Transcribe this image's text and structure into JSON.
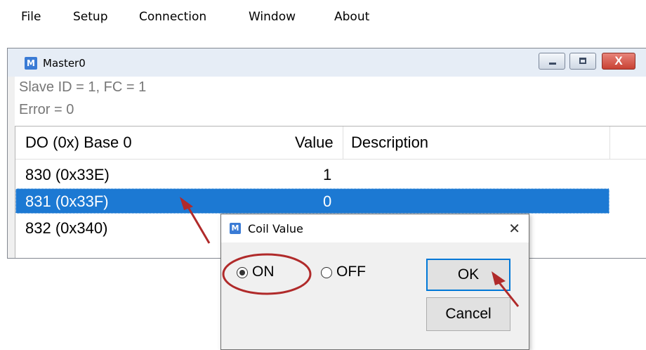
{
  "menubar": {
    "items": [
      "File",
      "Setup",
      "Connection",
      "Window",
      "About"
    ]
  },
  "mdi_window": {
    "title": "Master0",
    "info_lines": [
      "Slave ID = 1, FC = 1",
      "Error = 0"
    ],
    "columns": [
      "DO (0x) Base 0",
      "Value",
      "Description"
    ],
    "rows": [
      {
        "address": "830 (0x33E)",
        "value": "1",
        "description": ""
      },
      {
        "address": "831 (0x33F)",
        "value": "0",
        "description": ""
      },
      {
        "address": "832 (0x340)",
        "value": "",
        "description": ""
      }
    ],
    "selected_row": 1,
    "close_glyph": "X"
  },
  "dialog": {
    "title": "Coil Value",
    "close_glyph": "✕",
    "options": [
      {
        "label": "ON",
        "checked": true
      },
      {
        "label": "OFF",
        "checked": false
      }
    ],
    "ok_label": "OK",
    "cancel_label": "Cancel"
  },
  "icons": {
    "app": "M",
    "annotation_color": "#b02a2a"
  }
}
